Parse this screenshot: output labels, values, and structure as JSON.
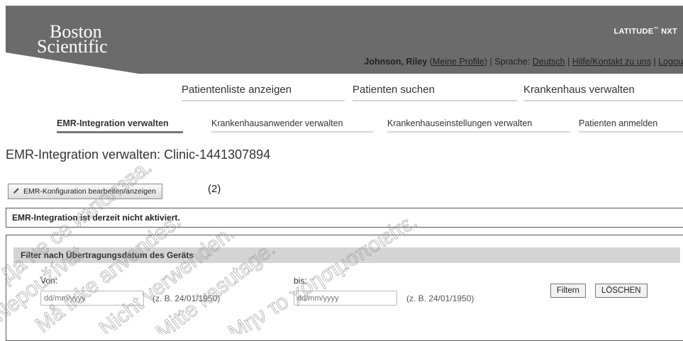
{
  "brand": {
    "logo_line1": "Boston",
    "logo_line2": "Scientific",
    "product": "LATITUDE",
    "product_tm": "™",
    "product_suffix": " NXT"
  },
  "userbar": {
    "user": "Johnson, Riley",
    "profile_link": "Meine Profile",
    "language_label": "Sprache:",
    "language": "Deutsch",
    "help_link": "Hilfe/Kontakt zu uns",
    "logout": "Logou",
    "sep": "|"
  },
  "mainnav": [
    "Patientenliste anzeigen",
    "Patienten suchen",
    "Krankenhaus verwalten"
  ],
  "subnav": [
    "EMR-Integration verwalten",
    "Krankenhausanwender verwalten",
    "Krankenhauseinstellungen verwalten",
    "Patienten anmelden"
  ],
  "page": {
    "title": "EMR-Integration verwalten: Clinic-1441307894",
    "edit_button": "EMR-Konfiguration bearbeiten/anzeigen",
    "callout": "(2)",
    "status": "EMR-Integration ist derzeit nicht aktiviert."
  },
  "filter": {
    "heading": "Filter nach Übertragungsdatum des Geräts",
    "from_label": "Von:",
    "to_label": "bis:",
    "placeholder": "dd/mm/yyyy",
    "hint": "(z. B. 24/01/1950)",
    "filter_button": "Filtern",
    "clear_button": "LÖSCHEN"
  },
  "watermark": [
    "Да не се използва.",
    "Nepoužívat.",
    "Må ikke anvendes.",
    "Nicht verwenden.",
    "Mitte kasutage.",
    "Μην το χρησιμοποιείτε."
  ],
  "icons": {
    "edit": "pencil-icon"
  },
  "colors": {
    "header_bg": "#6b6b6b",
    "filter_head_bg": "#d4d4d4"
  }
}
